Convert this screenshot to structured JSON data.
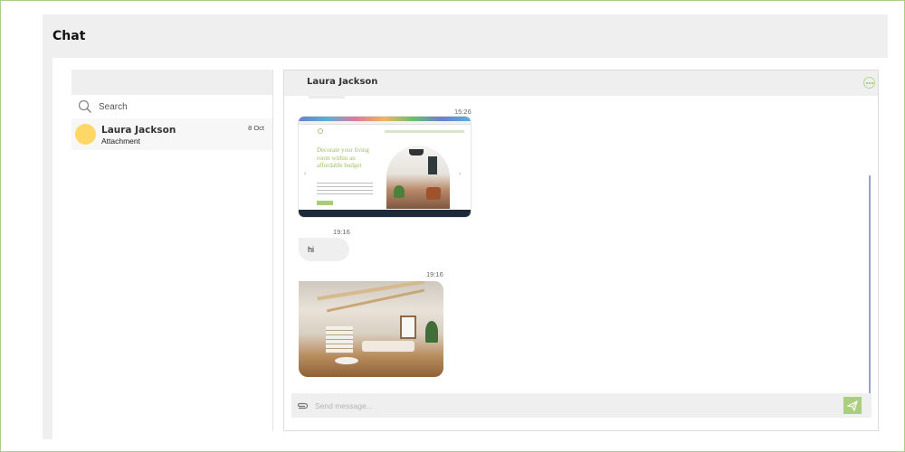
{
  "page": {
    "title": "Chat"
  },
  "sidebar": {
    "search_label": "Search",
    "conversations": [
      {
        "name": "Laura Jackson",
        "preview": "Attachment",
        "date": "8 Oct"
      }
    ]
  },
  "chat": {
    "contact_name": "Laura Jackson",
    "messages": [
      {
        "time": "15:26",
        "type": "image",
        "image_text": "Decorate your living room within an affordable budget"
      },
      {
        "time": "19:16",
        "type": "text",
        "text": "hi"
      },
      {
        "time": "19:16",
        "type": "image"
      }
    ],
    "input": {
      "placeholder": "Send message...",
      "value": ""
    }
  },
  "colors": {
    "accent": "#a9cf7e",
    "avatar": "#fed766",
    "frame_border": "#a9cf8c",
    "panel_bg": "#efefef",
    "scrollbar": "#8ea7d4"
  },
  "icons": {
    "search": "search-icon",
    "more": "more-options-icon",
    "attach": "paperclip-icon",
    "send": "send-icon"
  }
}
